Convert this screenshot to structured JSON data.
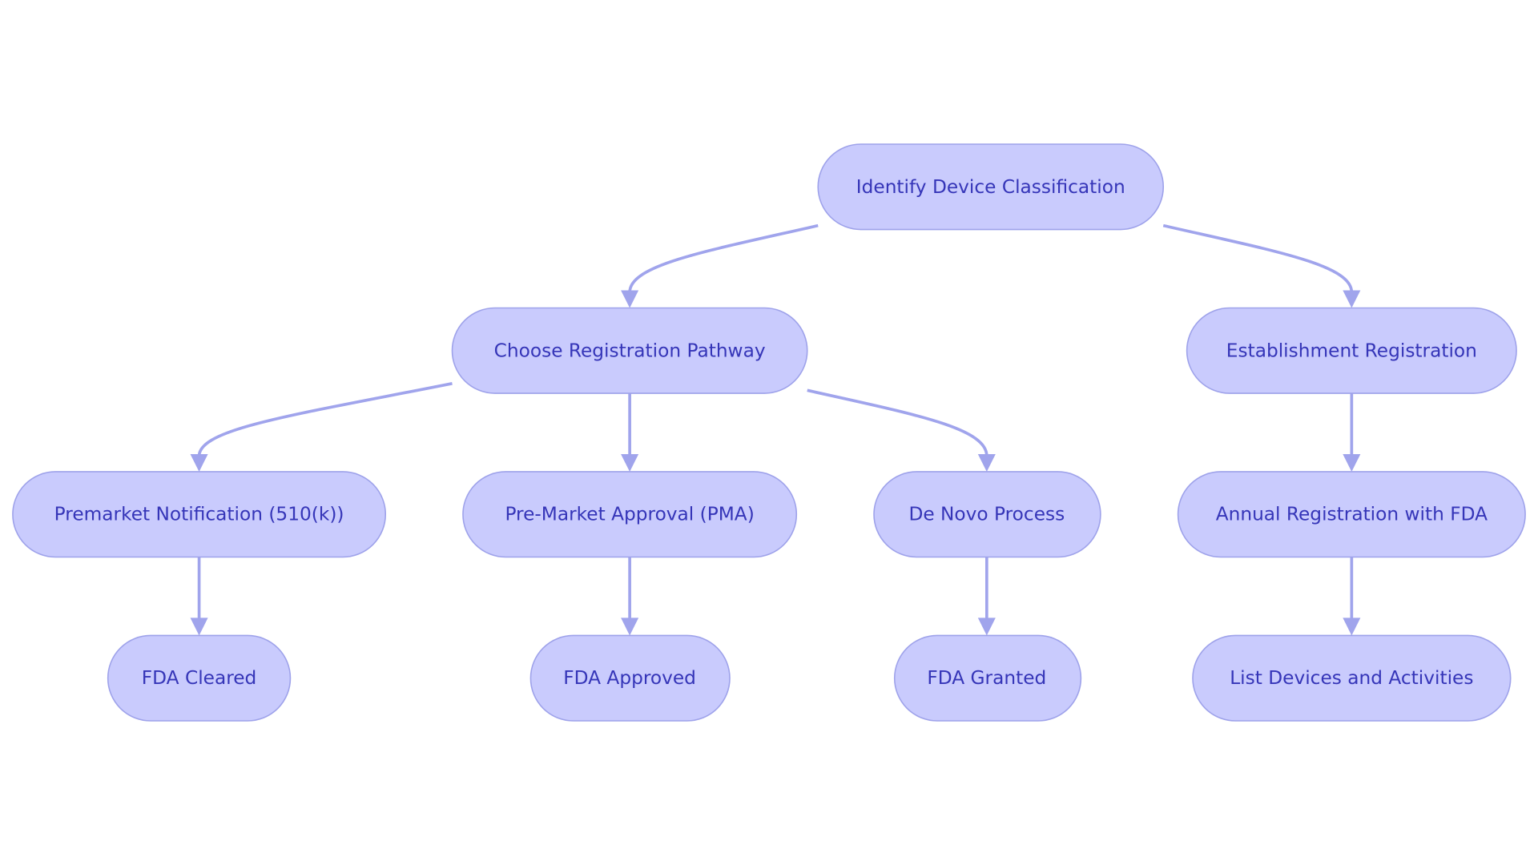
{
  "colors": {
    "node_fill": "#c9cbfd",
    "node_border": "#9ea2ea",
    "edge": "#a0a4ec",
    "text": "#3535b8"
  },
  "nodes": {
    "identify": "Identify Device Classification",
    "choose": "Choose Registration Pathway",
    "establishment": "Establishment Registration",
    "premarket": "Premarket Notification (510(k))",
    "pma": "Pre-Market Approval (PMA)",
    "denovo": "De Novo Process",
    "annual": "Annual Registration with FDA",
    "cleared": "FDA Cleared",
    "approved": "FDA Approved",
    "granted": "FDA Granted",
    "list": "List Devices and Activities"
  },
  "edges": [
    [
      "identify",
      "choose"
    ],
    [
      "identify",
      "establishment"
    ],
    [
      "choose",
      "premarket"
    ],
    [
      "choose",
      "pma"
    ],
    [
      "choose",
      "denovo"
    ],
    [
      "establishment",
      "annual"
    ],
    [
      "premarket",
      "cleared"
    ],
    [
      "pma",
      "approved"
    ],
    [
      "denovo",
      "granted"
    ],
    [
      "annual",
      "list"
    ]
  ]
}
